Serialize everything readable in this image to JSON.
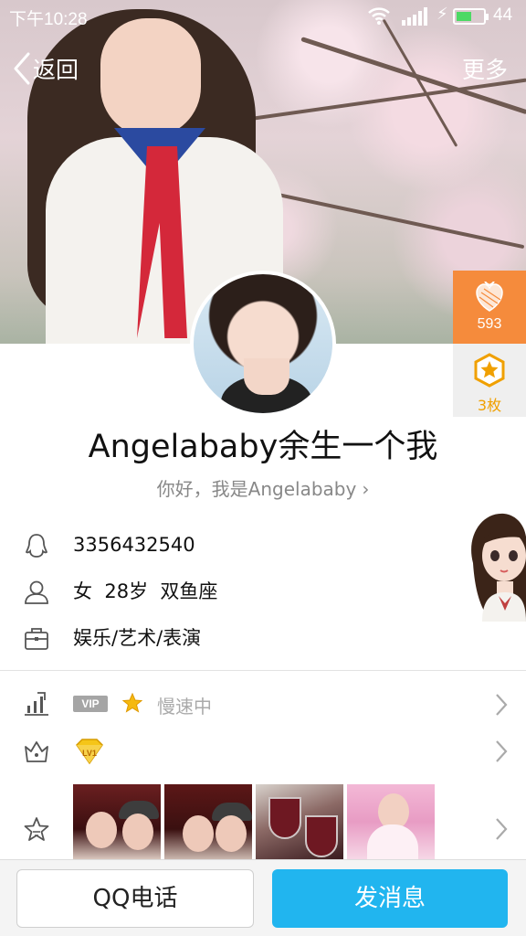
{
  "status_bar": {
    "time": "下午10:28",
    "battery_level": "44",
    "icons": [
      "wifi-icon",
      "signal-icon",
      "charging-icon",
      "battery-icon"
    ]
  },
  "nav": {
    "back_label": "返回",
    "more_label": "更多"
  },
  "side_badges": {
    "likes_count": "593",
    "medals_count": "3枚"
  },
  "profile": {
    "nickname": "Angelababy余生一个我",
    "signature": "你好，我是Angelababy",
    "qq_number": "3356432540",
    "basic_info": "女  28岁  双鱼座",
    "occupation": "娱乐/艺术/表演"
  },
  "features": {
    "vip_tag": "VIP",
    "vip_status": "慢速中",
    "level_badge": "LV1"
  },
  "actions": {
    "call_label": "QQ电话",
    "message_label": "发消息"
  },
  "colors": {
    "accent_blue": "#21b5ef",
    "badge_orange": "#f58b3c",
    "medal_gold": "#f0a000"
  }
}
